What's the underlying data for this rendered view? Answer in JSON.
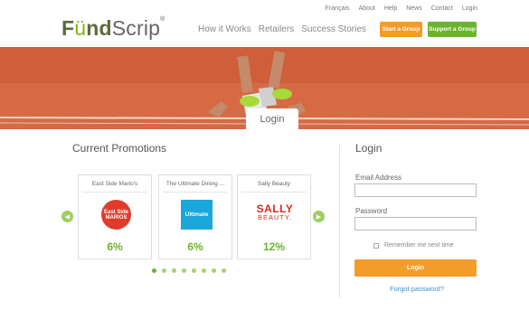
{
  "header": {
    "logo": {
      "part1": "F",
      "part2": "ü",
      "part3": "nd",
      "part4": "Scrip",
      "tm": "®"
    },
    "utility_links": [
      "Français",
      "About",
      "Help",
      "News",
      "Contact",
      "Login"
    ],
    "main_nav": [
      "How it Works",
      "Retailers",
      "Success Stories"
    ],
    "start_group_label": "Start a Group",
    "support_group_label": "Support a Group",
    "colors": {
      "orange": "#f39c2a",
      "green": "#6ab42d"
    }
  },
  "hero": {
    "tab_label": "Login",
    "track_color": "#d8643f"
  },
  "promotions": {
    "title": "Current Promotions",
    "cards": [
      {
        "name": "East Side Mario's",
        "logo_text": "East Side MARIOS",
        "percent": "6%"
      },
      {
        "name": "The Ultimate Dining ...",
        "logo_text": "Ultimate",
        "percent": "6%"
      },
      {
        "name": "Sally Beauty",
        "logo_text_1": "SALLY",
        "logo_text_2": "BEAUTY.",
        "percent": "12%"
      }
    ],
    "prev_icon": "chevron-left-icon",
    "next_icon": "chevron-right-icon",
    "page_count": 8,
    "active_page": 1
  },
  "login": {
    "title": "Login",
    "email_label": "Email Address",
    "email_value": "",
    "password_label": "Password",
    "password_value": "",
    "remember_label": "Remember me next time",
    "submit_label": "Login",
    "forgot_label": "Forgot password?"
  }
}
